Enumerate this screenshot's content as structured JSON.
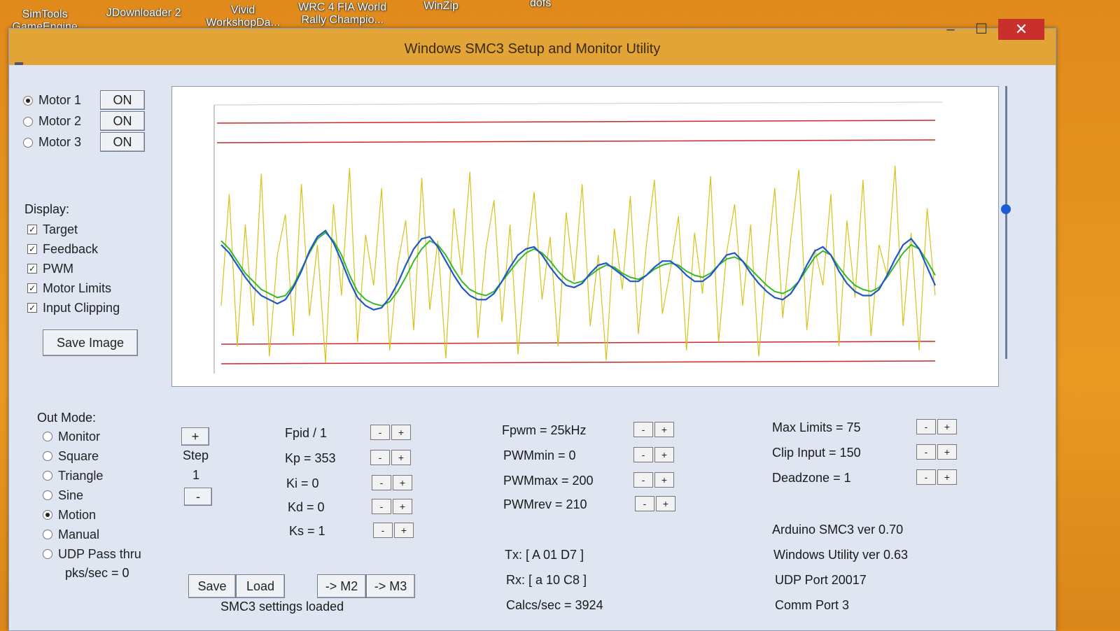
{
  "desktop_icons": [
    {
      "label1": "SimTools",
      "label2": "GameEngine"
    },
    {
      "label1": "JDownloader 2",
      "label2": ""
    },
    {
      "label1": "Vivid",
      "label2": "WorkshopDa..."
    },
    {
      "label1": "WRC 4 FIA World",
      "label2": "Rally Champio..."
    },
    {
      "label1": "WinZip",
      "label2": ""
    },
    {
      "label1": "dofs",
      "label2": ""
    }
  ],
  "window": {
    "title": "Windows SMC3 Setup and Monitor Utility",
    "minimize": "–",
    "maximize": "☐",
    "close": "✕"
  },
  "motors": [
    {
      "label": "Motor 1",
      "state": "ON",
      "selected": true
    },
    {
      "label": "Motor 2",
      "state": "ON",
      "selected": false
    },
    {
      "label": "Motor 3",
      "state": "ON",
      "selected": false
    }
  ],
  "display": {
    "heading": "Display:",
    "items": [
      {
        "label": "Target",
        "checked": true
      },
      {
        "label": "Feedback",
        "checked": true
      },
      {
        "label": "PWM",
        "checked": true
      },
      {
        "label": "Motor Limits",
        "checked": true
      },
      {
        "label": "Input Clipping",
        "checked": true
      }
    ],
    "save_image": "Save Image"
  },
  "out_mode": {
    "heading": "Out Mode:",
    "items": [
      {
        "label": "Monitor",
        "selected": false
      },
      {
        "label": "Square",
        "selected": false
      },
      {
        "label": "Triangle",
        "selected": false
      },
      {
        "label": "Sine",
        "selected": false
      },
      {
        "label": "Motion",
        "selected": true
      },
      {
        "label": "Manual",
        "selected": false
      },
      {
        "label": "UDP Pass thru",
        "selected": false
      }
    ],
    "pks": "pks/sec = 0"
  },
  "step": {
    "plus": "+",
    "label": "Step",
    "value": "1",
    "minus": "-"
  },
  "pid": [
    {
      "label": "Fpid / 1"
    },
    {
      "label": "Kp = 353"
    },
    {
      "label": "Ki = 0"
    },
    {
      "label": "Kd = 0"
    },
    {
      "label": "Ks = 1"
    }
  ],
  "pwm": [
    {
      "label": "Fpwm = 25kHz"
    },
    {
      "label": "PWMmin = 0"
    },
    {
      "label": "PWMmax = 200"
    },
    {
      "label": "PWMrev = 210"
    }
  ],
  "limits": [
    {
      "label": "Max Limits = 75"
    },
    {
      "label": "Clip Input = 150"
    },
    {
      "label": "Deadzone = 1"
    }
  ],
  "buttons": {
    "save": "Save",
    "load": "Load",
    "m2": "-> M2",
    "m3": "-> M3",
    "minus": "-",
    "plus": "+"
  },
  "status": {
    "settings": "SMC3 settings loaded",
    "tx": "Tx: [ A 01 D7 ]",
    "rx": "Rx: [ a 10 C8 ]",
    "calcs": "Calcs/sec = 3924"
  },
  "info": {
    "arduino": "Arduino SMC3 ver 0.70",
    "utility": "Windows Utility ver 0.63",
    "udp": "UDP Port 20017",
    "comm": "Comm Port 3"
  },
  "slider": {
    "level": 0.55
  },
  "plot": {
    "colors": {
      "target": "#37b82b",
      "feedback": "#1f57c9",
      "pwm": "#d6c21a",
      "limits": "#cc2a2a",
      "clip": "#cc2a2a"
    },
    "target": [
      0.62,
      0.58,
      0.52,
      0.46,
      0.42,
      0.38,
      0.36,
      0.34,
      0.35,
      0.4,
      0.48,
      0.56,
      0.63,
      0.66,
      0.62,
      0.55,
      0.45,
      0.37,
      0.33,
      0.31,
      0.3,
      0.32,
      0.37,
      0.44,
      0.52,
      0.58,
      0.62,
      0.6,
      0.55,
      0.48,
      0.42,
      0.38,
      0.36,
      0.35,
      0.37,
      0.42,
      0.47,
      0.52,
      0.56,
      0.58,
      0.56,
      0.52,
      0.47,
      0.43,
      0.41,
      0.42,
      0.45,
      0.48,
      0.5,
      0.49,
      0.46,
      0.44,
      0.43,
      0.45,
      0.48,
      0.5,
      0.51,
      0.5,
      0.47,
      0.45,
      0.44,
      0.46,
      0.5,
      0.53,
      0.54,
      0.52,
      0.48,
      0.44,
      0.4,
      0.37,
      0.36,
      0.38,
      0.42,
      0.48,
      0.54,
      0.57,
      0.55,
      0.49,
      0.44,
      0.4,
      0.38,
      0.37,
      0.39,
      0.44,
      0.5,
      0.56,
      0.6,
      0.58,
      0.52,
      0.45
    ],
    "feedback": [
      0.6,
      0.56,
      0.5,
      0.44,
      0.39,
      0.35,
      0.33,
      0.31,
      0.33,
      0.39,
      0.47,
      0.57,
      0.64,
      0.67,
      0.61,
      0.52,
      0.42,
      0.34,
      0.3,
      0.28,
      0.29,
      0.34,
      0.41,
      0.5,
      0.58,
      0.63,
      0.64,
      0.59,
      0.52,
      0.45,
      0.39,
      0.35,
      0.33,
      0.33,
      0.36,
      0.42,
      0.49,
      0.55,
      0.58,
      0.59,
      0.55,
      0.49,
      0.44,
      0.4,
      0.39,
      0.41,
      0.46,
      0.5,
      0.51,
      0.48,
      0.45,
      0.42,
      0.42,
      0.45,
      0.49,
      0.52,
      0.52,
      0.49,
      0.45,
      0.42,
      0.42,
      0.45,
      0.5,
      0.55,
      0.56,
      0.52,
      0.46,
      0.41,
      0.37,
      0.34,
      0.33,
      0.36,
      0.42,
      0.5,
      0.57,
      0.59,
      0.55,
      0.47,
      0.41,
      0.37,
      0.35,
      0.35,
      0.38,
      0.45,
      0.53,
      0.6,
      0.63,
      0.58,
      0.49,
      0.4
    ],
    "pwm": [
      0.3,
      0.85,
      0.1,
      0.7,
      0.2,
      0.95,
      0.05,
      0.55,
      0.75,
      0.15,
      0.9,
      0.25,
      0.6,
      0.02,
      0.8,
      0.35,
      0.98,
      0.12,
      0.65,
      0.4,
      0.88,
      0.08,
      0.5,
      0.72,
      0.18,
      0.93,
      0.28,
      0.62,
      0.04,
      0.78,
      0.45,
      0.96,
      0.14,
      0.58,
      0.82,
      0.22,
      0.7,
      0.06,
      0.52,
      0.86,
      0.33,
      0.64,
      0.1,
      0.76,
      0.42,
      0.9,
      0.2,
      0.55,
      0.03,
      0.68,
      0.38,
      0.84,
      0.16,
      0.6,
      0.92,
      0.26,
      0.48,
      0.74,
      0.08,
      0.66,
      0.36,
      0.94,
      0.12,
      0.56,
      0.8,
      0.3,
      0.7,
      0.05,
      0.5,
      0.88,
      0.24,
      0.63,
      0.97,
      0.18,
      0.58,
      0.4,
      0.85,
      0.1,
      0.72,
      0.34,
      0.92,
      0.15,
      0.6,
      0.45,
      0.99,
      0.2,
      0.66,
      0.08,
      0.78,
      0.35
    ]
  }
}
